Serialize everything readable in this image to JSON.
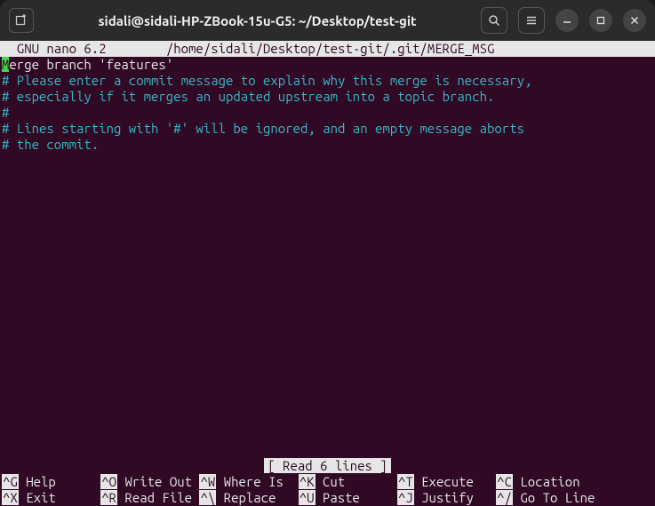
{
  "window": {
    "title": "sidali@sidali-HP-ZBook-15u-G5: ~/Desktop/test-git"
  },
  "nano": {
    "app_name": "  GNU nano 6.2",
    "file_path": "/home/sidali/Desktop/test-git/.git/MERGE_MSG",
    "status": "[ Read 6 lines ]"
  },
  "content": {
    "line1_first_char": "M",
    "line1_rest": "erge branch 'features'",
    "comments": [
      "# Please enter a commit message to explain why this merge is necessary,",
      "# especially if it merges an updated upstream into a topic branch.",
      "#",
      "# Lines starting with '#' will be ignored, and an empty message aborts",
      "# the commit."
    ]
  },
  "shortcuts": {
    "row1": [
      {
        "key": "^G",
        "label": "Help"
      },
      {
        "key": "^O",
        "label": "Write Out"
      },
      {
        "key": "^W",
        "label": "Where Is"
      },
      {
        "key": "^K",
        "label": "Cut"
      },
      {
        "key": "^T",
        "label": "Execute"
      },
      {
        "key": "^C",
        "label": "Location"
      }
    ],
    "row2": [
      {
        "key": "^X",
        "label": "Exit"
      },
      {
        "key": "^R",
        "label": "Read File"
      },
      {
        "key": "^\\",
        "label": "Replace"
      },
      {
        "key": "^U",
        "label": "Paste"
      },
      {
        "key": "^J",
        "label": "Justify"
      },
      {
        "key": "^/",
        "label": "Go To Line"
      }
    ]
  }
}
